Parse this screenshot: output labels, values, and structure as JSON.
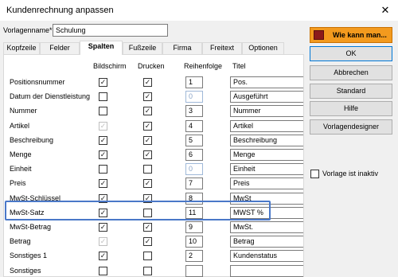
{
  "window": {
    "title": "Kundenrechnung anpassen",
    "close_glyph": "✕"
  },
  "vorlage": {
    "label": "Vorlagenname*",
    "value": "Schulung"
  },
  "tabs": [
    {
      "label": "Kopfzeile"
    },
    {
      "label": "Felder"
    },
    {
      "label": "Spalten",
      "active": true
    },
    {
      "label": "Fußzeile"
    },
    {
      "label": "Firma"
    },
    {
      "label": "Freitext"
    },
    {
      "label": "Optionen"
    }
  ],
  "columns": {
    "bildschirm": "Bildschirm",
    "drucken": "Drucken",
    "reihenfolge": "Reihenfolge",
    "titel": "Titel"
  },
  "rows": [
    {
      "label": "Positionsnummer",
      "bildschirm": true,
      "bildschirm_disabled": false,
      "drucken": true,
      "reihenfolge": "1",
      "reihenfolge_disabled": false,
      "titel": "Pos."
    },
    {
      "label": "Datum der Dienstleistung",
      "bildschirm": false,
      "bildschirm_disabled": false,
      "drucken": true,
      "reihenfolge": "0",
      "reihenfolge_disabled": true,
      "titel": "Ausgeführt"
    },
    {
      "label": "Nummer",
      "bildschirm": false,
      "bildschirm_disabled": false,
      "drucken": true,
      "reihenfolge": "3",
      "reihenfolge_disabled": false,
      "titel": "Nummer"
    },
    {
      "label": "Artikel",
      "bildschirm": true,
      "bildschirm_disabled": true,
      "drucken": true,
      "reihenfolge": "4",
      "reihenfolge_disabled": false,
      "titel": "Artikel"
    },
    {
      "label": "Beschreibung",
      "bildschirm": true,
      "bildschirm_disabled": false,
      "drucken": true,
      "reihenfolge": "5",
      "reihenfolge_disabled": false,
      "titel": "Beschreibung"
    },
    {
      "label": "Menge",
      "bildschirm": true,
      "bildschirm_disabled": false,
      "drucken": true,
      "reihenfolge": "6",
      "reihenfolge_disabled": false,
      "titel": "Menge"
    },
    {
      "label": "Einheit",
      "bildschirm": false,
      "bildschirm_disabled": false,
      "drucken": false,
      "reihenfolge": "0",
      "reihenfolge_disabled": true,
      "titel": "Einheit"
    },
    {
      "label": "Preis",
      "bildschirm": true,
      "bildschirm_disabled": false,
      "drucken": true,
      "reihenfolge": "7",
      "reihenfolge_disabled": false,
      "titel": "Preis"
    },
    {
      "label": "MwSt-Schlüssel",
      "bildschirm": true,
      "bildschirm_disabled": false,
      "drucken": true,
      "reihenfolge": "8",
      "reihenfolge_disabled": false,
      "titel": "MwSt"
    },
    {
      "label": "MwSt-Satz",
      "bildschirm": true,
      "bildschirm_disabled": false,
      "drucken": false,
      "reihenfolge": "11",
      "reihenfolge_disabled": false,
      "titel": "MWST %"
    },
    {
      "label": "MwSt-Betrag",
      "bildschirm": true,
      "bildschirm_disabled": false,
      "drucken": true,
      "reihenfolge": "9",
      "reihenfolge_disabled": false,
      "titel": "MwSt."
    },
    {
      "label": "Betrag",
      "bildschirm": true,
      "bildschirm_disabled": true,
      "drucken": true,
      "reihenfolge": "10",
      "reihenfolge_disabled": false,
      "titel": "Betrag"
    },
    {
      "label": "Sonstiges 1",
      "bildschirm": true,
      "bildschirm_disabled": false,
      "drucken": false,
      "reihenfolge": "2",
      "reihenfolge_disabled": false,
      "titel": "Kundenstatus"
    },
    {
      "label": "Sonstiges",
      "bildschirm": false,
      "bildschirm_disabled": false,
      "drucken": false,
      "reihenfolge": "",
      "reihenfolge_disabled": false,
      "titel": ""
    }
  ],
  "buttons": {
    "help": "Wie kann man...",
    "ok": "OK",
    "cancel": "Abbrechen",
    "standard": "Standard",
    "hilfe": "Hilfe",
    "designer": "Vorlagendesigner"
  },
  "inaktiv": {
    "label": "Vorlage ist inaktiv",
    "checked": false
  },
  "colors": {
    "help_button": "#f39a1e",
    "highlight": "#4a78c8",
    "ok_border": "#0078d7"
  },
  "icons": {
    "help_icon": "gift-box-icon",
    "close_icon": "close-icon"
  }
}
